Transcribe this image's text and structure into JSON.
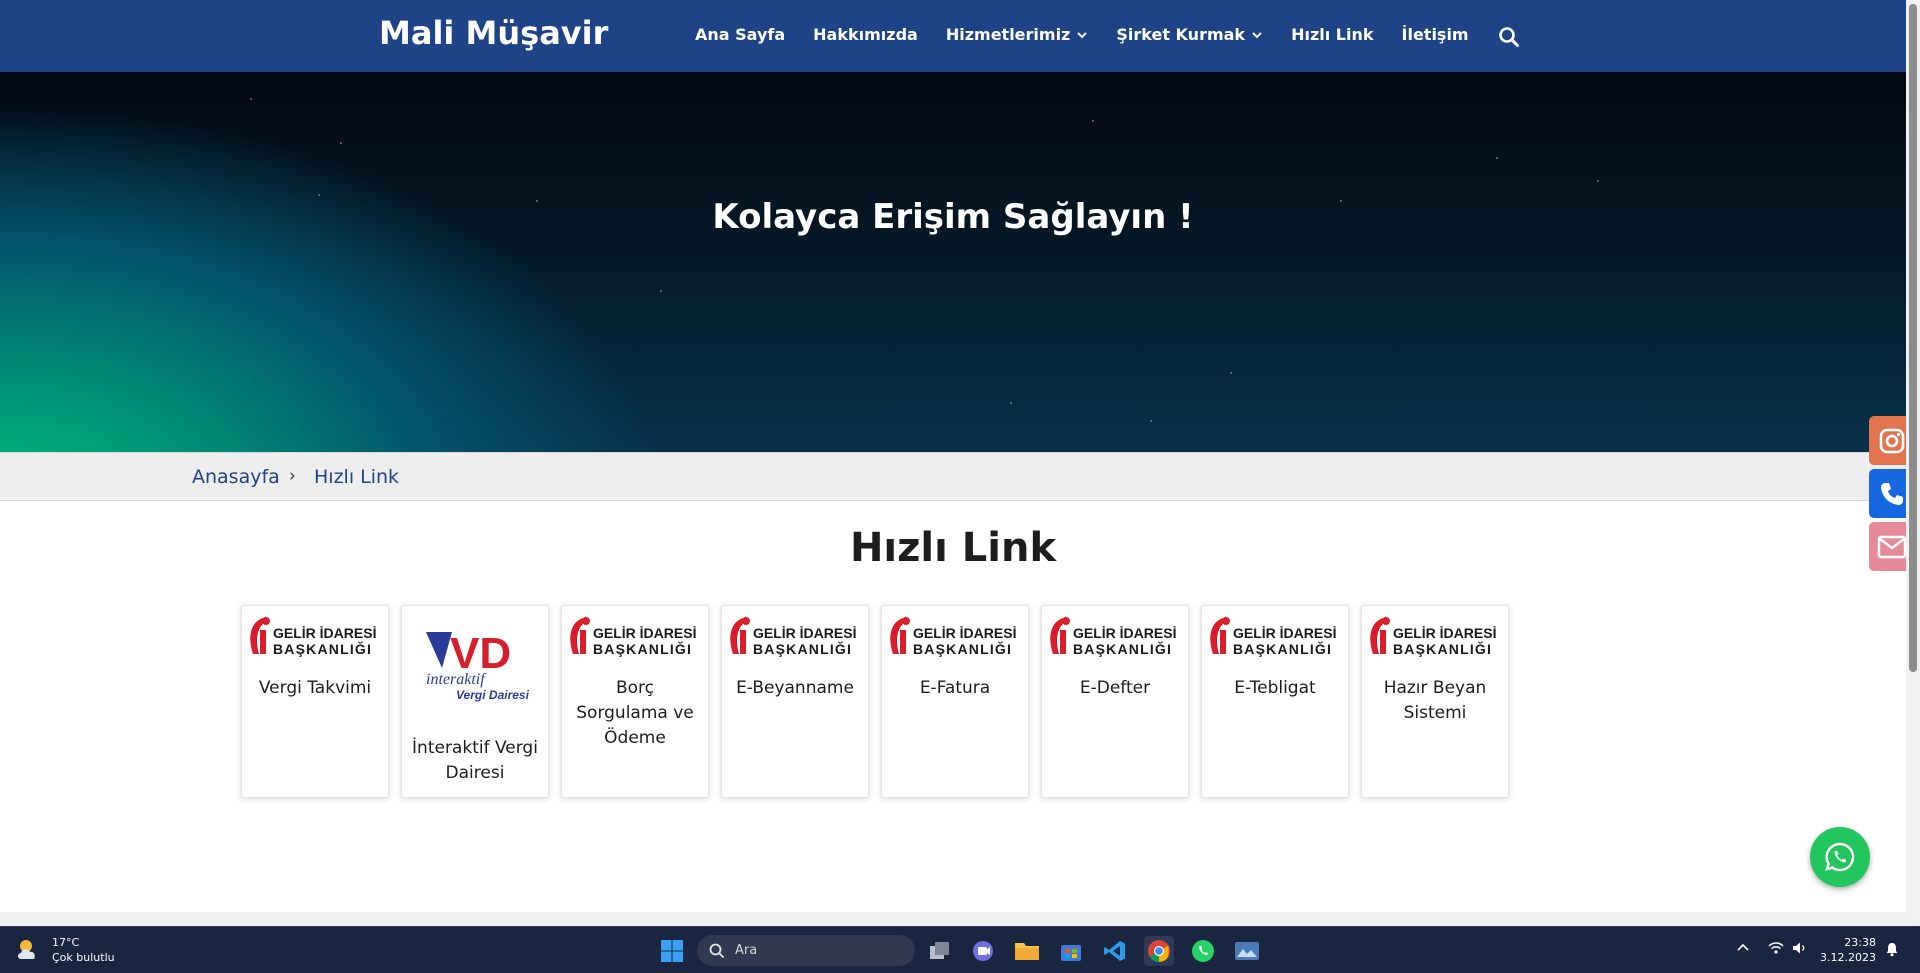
{
  "header": {
    "brand": "Mali Müşavir",
    "menu": [
      {
        "label": "Ana Sayfa"
      },
      {
        "label": "Hakkımızda"
      },
      {
        "label": "Hizmetlerimiz"
      },
      {
        "label": "Şirket Kurmak"
      },
      {
        "label": "Hızlı Link"
      },
      {
        "label": "İletişim"
      }
    ],
    "search_icon": "search-icon",
    "color": "#1f4387"
  },
  "hero": {
    "title": "Kolayca Erişim Sağlayın !"
  },
  "breadcrumb": {
    "home": "Anasayfa",
    "separator": "›",
    "current": "Hızlı Link"
  },
  "section": {
    "title": "Hızlı Link",
    "cards": [
      {
        "logo": "gib",
        "label": "Vergi Takvimi"
      },
      {
        "logo": "ivd",
        "label": "İnteraktif Vergi Dairesi"
      },
      {
        "logo": "gib",
        "label": "Borç Sorgulama ve Ödeme"
      },
      {
        "logo": "gib",
        "label": "E-Beyanname"
      },
      {
        "logo": "gib",
        "label": "E-Fatura"
      },
      {
        "logo": "gib",
        "label": "E-Defter"
      },
      {
        "logo": "gib",
        "label": "E-Tebligat"
      },
      {
        "logo": "gib",
        "label": "Hazır Beyan Sistemi"
      }
    ],
    "logos": {
      "gib_line1": "GELİR İDARESİ",
      "gib_line2": "BAŞKANLIĞI",
      "ivd_mark": "VD",
      "ivd_line1": "interaktif",
      "ivd_line2": "Vergi Dairesi"
    }
  },
  "floating": {
    "instagram": {
      "icon": "instagram-icon",
      "color": "#e2744f"
    },
    "phone": {
      "icon": "phone-icon",
      "color": "#1768e0"
    },
    "email": {
      "icon": "mail-icon",
      "color": "#e58a99"
    },
    "whatsapp": {
      "icon": "whatsapp-icon",
      "color": "#22c55e"
    }
  },
  "taskbar": {
    "weather_temp": "17°C",
    "weather_desc": "Çok bulutlu",
    "search_placeholder": "Ara",
    "time": "23:38",
    "date": "3.12.2023"
  }
}
